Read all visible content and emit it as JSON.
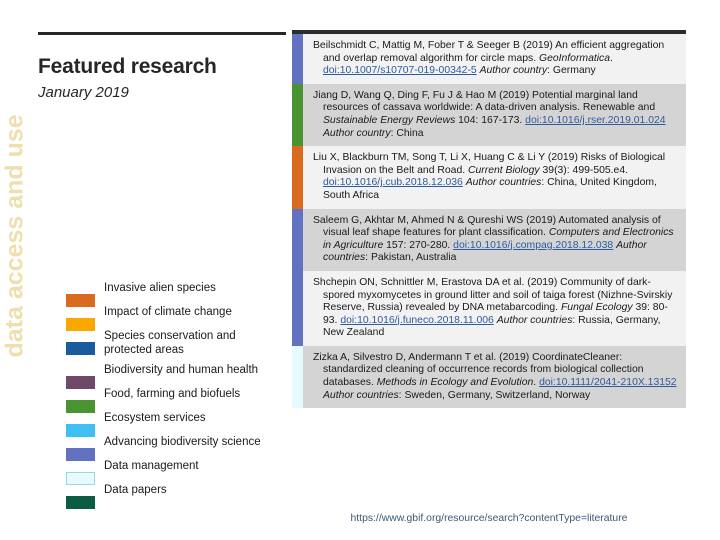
{
  "side_banner": {
    "text": "data access and use",
    "color": "#f0dfae"
  },
  "header": {
    "title": "Featured research",
    "subtitle": "January 2019",
    "rule_color": "#262626"
  },
  "legend": {
    "items": [
      {
        "label": "Invasive alien species",
        "color": "#d96a1f",
        "border": "#d96a1f"
      },
      {
        "label": "Impact of climate change",
        "color": "#f9a800",
        "border": "#f9a800"
      },
      {
        "label": "Species conservation and protected areas",
        "color": "#1a5b9e",
        "border": "#1a5b9e"
      },
      {
        "label": "Biodiversity and human health",
        "color": "#6e4a68",
        "border": "#6e4a68"
      },
      {
        "label": "Food, farming and biofuels",
        "color": "#4a9331",
        "border": "#4a9331"
      },
      {
        "label": "Ecosystem services",
        "color": "#3ec0f5",
        "border": "#3ec0f5"
      },
      {
        "label": "Advancing biodiversity science",
        "color": "#6272c0",
        "border": "#6272c0"
      },
      {
        "label": "Data management",
        "color": "#e6fbff",
        "border": "#9fd4e0"
      },
      {
        "label": "Data papers",
        "color": "#0c5c44",
        "border": "#0c5c44"
      }
    ]
  },
  "publications": [
    {
      "category_color": "#6272c0",
      "shade": "shade-a",
      "authors_title": "Beilschmidt C, Mattig M, Fober T & Seeger B (2019) An efficient aggregation and overlap removal algorithm for circle maps. ",
      "journal": "GeoInformatica",
      "journal_suffix": ". ",
      "doi": "doi:10.1007/s10707-019-00342-5",
      "author_country_label": "Author country",
      "author_country_value": ": Germany"
    },
    {
      "category_color": "#4a9331",
      "shade": "shade-b",
      "authors_title": "Jiang D, Wang Q, Ding F, Fu J & Hao M (2019) Potential marginal land resources of cassava worldwide: A data-driven analysis. Renewable and ",
      "journal": "Sustainable Energy Reviews",
      "journal_suffix": " 104: 167-173. ",
      "doi": "doi:10.1016/j.rser.2019.01.024",
      "author_country_label": "Author country",
      "author_country_value": ": China"
    },
    {
      "category_color": "#d96a1f",
      "shade": "shade-a",
      "authors_title": "Liu X, Blackburn TM, Song T, Li X, Huang C & Li Y (2019) Risks of Biological Invasion on the Belt and Road. ",
      "journal": "Current Biology",
      "journal_suffix": " 39(3): 499-505.e4. ",
      "doi": "doi:10.1016/j.cub.2018.12.036",
      "author_country_label": "Author countries",
      "author_country_value": ": China, United Kingdom, South Africa"
    },
    {
      "category_color": "#6272c0",
      "shade": "shade-b",
      "authors_title": "Saleem G, Akhtar M, Ahmed N & Qureshi WS (2019) Automated analysis of visual leaf shape features for plant classification. ",
      "journal": "Computers and Electronics in Agriculture",
      "journal_suffix": " 157: 270-280. ",
      "doi": "doi:10.1016/j.compag.2018.12.038",
      "author_country_label": "Author countries",
      "author_country_value": ": Pakistan, Australia"
    },
    {
      "category_color": "#6272c0",
      "shade": "shade-a",
      "authors_title": "Shchepin ON, Schnittler M, Erastova DA et al. (2019) Community of dark-spored myxomycetes in ground litter and soil of taiga forest (Nizhne-Svirskiy Reserve, Russia) revealed by DNA metabarcoding. ",
      "journal": "Fungal Ecology",
      "journal_suffix": " 39: 80-93. ",
      "doi": "doi:10.1016/j.funeco.2018.11.006",
      "author_country_label": "Author countries",
      "author_country_value": ": Russia, Germany, New Zealand"
    },
    {
      "category_color": "#e6fbff",
      "shade": "shade-b",
      "authors_title": "Zizka A, Silvestro D, Andermann T et al. (2019) CoordinateCleaner: standardized cleaning of occurrence records from biological collection databases. ",
      "journal": "Methods in Ecology and Evolution",
      "journal_suffix": ". ",
      "doi": "doi:10.1111/2041-210X.13152",
      "author_country_label": "Author countries",
      "author_country_value": ": Sweden, Germany, Switzerland, Norway"
    }
  ],
  "footer": {
    "source_url": "https://www.gbif.org/resource/search?contentType=literature"
  }
}
